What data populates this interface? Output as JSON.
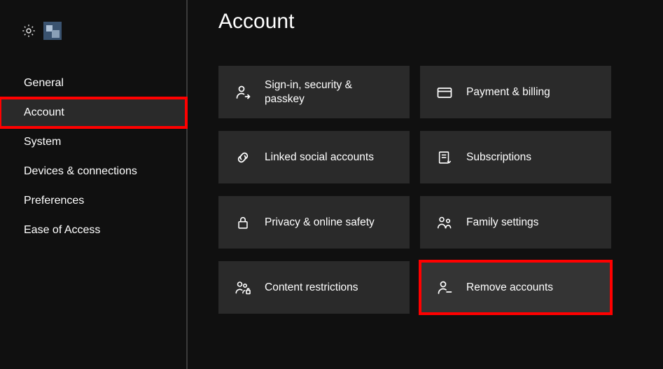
{
  "page_title": "Account",
  "sidebar": {
    "items": [
      {
        "label": "General"
      },
      {
        "label": "Account"
      },
      {
        "label": "System"
      },
      {
        "label": "Devices & connections"
      },
      {
        "label": "Preferences"
      },
      {
        "label": "Ease of Access"
      }
    ],
    "selected_index": 1
  },
  "tiles": [
    {
      "icon": "person-arrow-icon",
      "label": "Sign-in, security & passkey"
    },
    {
      "icon": "card-icon",
      "label": "Payment & billing"
    },
    {
      "icon": "link-icon",
      "label": "Linked social accounts"
    },
    {
      "icon": "receipt-icon",
      "label": "Subscriptions"
    },
    {
      "icon": "lock-icon",
      "label": "Privacy & online safety"
    },
    {
      "icon": "family-icon",
      "label": "Family settings"
    },
    {
      "icon": "person-lock-icon",
      "label": "Content restrictions"
    },
    {
      "icon": "person-minus-icon",
      "label": "Remove accounts"
    }
  ],
  "highlight": {
    "sidebar_index": 1,
    "tile_index": 7
  }
}
